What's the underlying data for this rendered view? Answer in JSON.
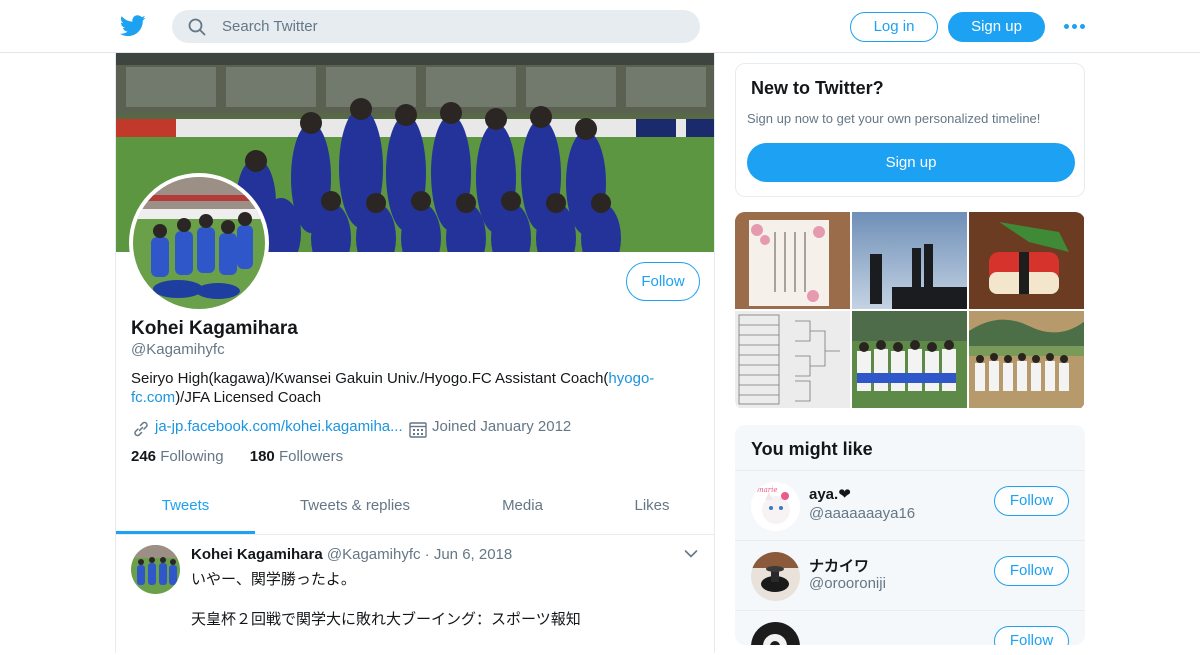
{
  "header": {
    "search_placeholder": "Search Twitter",
    "login_label": "Log in",
    "signup_label": "Sign up",
    "brand_color": "#1da1f2"
  },
  "profile": {
    "name": "Kohei Kagamihara",
    "handle": "@Kagamihyfc",
    "follow_label": "Follow",
    "bio_before": "Seiryo High(kagawa)/Kwansei Gakuin Univ./Hyogo.FC Assistant Coach(",
    "bio_link": "hyogo-fc.com",
    "bio_after": ")/JFA Licensed Coach",
    "website": "ja-jp.facebook.com/kohei.kagamiha...",
    "joined": "Joined January 2012",
    "following_count": "246",
    "following_label": "Following",
    "followers_count": "180",
    "followers_label": "Followers"
  },
  "tabs": [
    {
      "label": "Tweets",
      "active": true
    },
    {
      "label": "Tweets & replies",
      "active": false
    },
    {
      "label": "Media",
      "active": false
    },
    {
      "label": "Likes",
      "active": false
    }
  ],
  "tweet": {
    "author": "Kohei Kagamihara",
    "handle": "@Kagamihyfc",
    "separator": "·",
    "date": "Jun 6, 2018",
    "line1": "いやー、関学勝ったよ。",
    "line2": "天皇杯２回戦で関学大に敗れ大ブーイング：スポーツ報知"
  },
  "signup_card": {
    "title": "New to Twitter?",
    "subtitle": "Sign up now to get your own personalized timeline!",
    "button": "Sign up"
  },
  "you_might_like": {
    "title": "You might like",
    "users": [
      {
        "name": "aya.❤",
        "handle": "@aaaaaaaya16",
        "follow_label": "Follow"
      },
      {
        "name": "ナカイワ",
        "handle": "@orooroniji",
        "follow_label": "Follow"
      }
    ]
  }
}
